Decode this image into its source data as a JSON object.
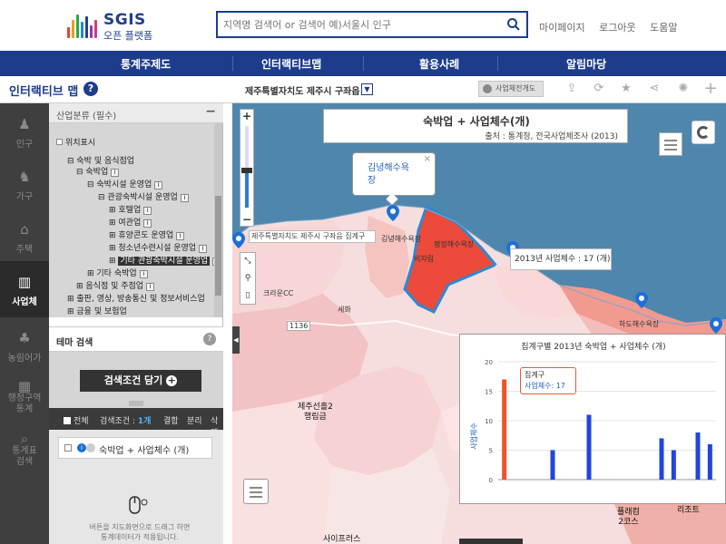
{
  "header": {
    "logo_main": "SGIS",
    "logo_sub": "오픈 플랫폼",
    "search_placeholder": "지역명 검색어 or 검색어 예)서울시 인구",
    "links": [
      "마이페이지",
      "로그아웃",
      "도움말"
    ]
  },
  "nav": [
    "통계주제도",
    "인터랙티브맵",
    "활용사례",
    "알림마당"
  ],
  "subbar": {
    "title": "인터랙티브 맵",
    "location": "제주특별자치도 제주시 구좌읍",
    "settings_btn": "사업체전개도"
  },
  "sidebar": [
    {
      "label": "인구",
      "icon": "person-icon"
    },
    {
      "label": "가구",
      "icon": "family-icon"
    },
    {
      "label": "주택",
      "icon": "house-icon"
    },
    {
      "label": "사업체",
      "icon": "building-icon",
      "active": true
    },
    {
      "label": "농림어가",
      "icon": "farm-icon"
    },
    {
      "label": "행정구역\n통계",
      "icon": "district-icon"
    },
    {
      "label": "통계표\n검색",
      "icon": "table-search-icon"
    }
  ],
  "panel": {
    "header": "산업분류 (필수)",
    "location_toggle": "위치표시",
    "tree": [
      {
        "label": "숙박 및 음식점업",
        "indent": 0
      },
      {
        "label": "숙박업",
        "indent": 1
      },
      {
        "label": "숙박시설 운영업",
        "indent": 2
      },
      {
        "label": "관광숙박시설 운영업",
        "indent": 3
      },
      {
        "label": "호텔업",
        "indent": 4
      },
      {
        "label": "여관업",
        "indent": 4
      },
      {
        "label": "휴양콘도 운영업",
        "indent": 4
      },
      {
        "label": "청소년수련시설 운영업",
        "indent": 4
      },
      {
        "label": "기타 관광숙박시설 운영업",
        "indent": 4,
        "selected": true
      },
      {
        "label": "기타 숙박업",
        "indent": 2
      },
      {
        "label": "음식점 및 주점업",
        "indent": 1
      },
      {
        "label": "출판, 영상, 방송통신 및 정보서비스업",
        "indent": 0
      },
      {
        "label": "금융 및 보험업",
        "indent": 0
      }
    ],
    "theme_search": "테마 검색",
    "add_button": "검색조건 담기",
    "search_bar": {
      "all": "전체",
      "cond_label": "검색조건 :",
      "count": "1개",
      "tabs": [
        "결합",
        "분리",
        "삭제"
      ]
    },
    "item_label": "숙박업 + 사업체수 (개)",
    "hint": "버튼을 지도화면으로 드래그 하면\n통계데이터가 적용됩니다."
  },
  "map": {
    "title": "숙박업 + 사업체수(개)",
    "source": "출처 : 통계청, 전국사업체조사 (2013)",
    "popup": "김녕해수욕\n장",
    "tooltip_area": "제주특별자치도 제주시 구좌읍 집계구",
    "tooltip_value": "2013년 사업체수 : 17 (개)",
    "labels": [
      "김녕해수욕장",
      "평정해수욕장",
      "비자림",
      "크라운CC",
      "세화",
      "하도해수욕장",
      "제주선흘2\n행림금",
      "사이프러스",
      "플래컴\n2코스",
      "리조트"
    ],
    "road_label": "1136"
  },
  "chart_data": {
    "type": "bar",
    "title": "집계구별 2013년 숙박업 + 사업체수 (개)",
    "ylabel": "사업체수",
    "ylim": [
      0,
      20
    ],
    "yticks": [
      0,
      5,
      10,
      15,
      20
    ],
    "values": [
      17,
      0,
      0,
      0,
      5,
      0,
      0,
      11,
      0,
      0,
      0,
      0,
      0,
      7,
      5,
      0,
      8,
      6
    ],
    "highlight_index": 0,
    "colors": {
      "highlight": "#f0522a",
      "normal": "#2244dd"
    },
    "tooltip": {
      "label": "집계구",
      "value_label": "사업체수",
      "value": 17
    }
  }
}
